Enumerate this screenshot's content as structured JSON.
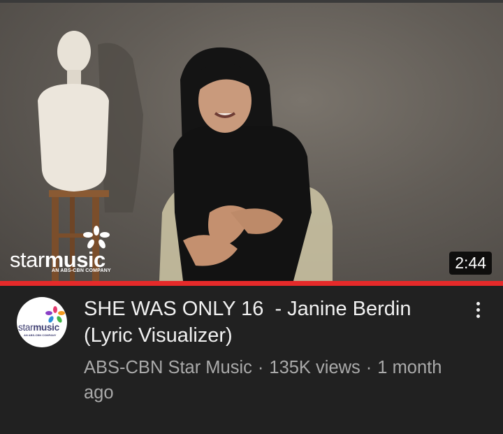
{
  "video": {
    "title": "SHE WAS ONLY 16  - Janine Berdin (Lyric Visualizer)",
    "duration": "2:44",
    "progress_fraction": 1.0,
    "colors": {
      "progress": "#e52a2a",
      "background": "#212121",
      "meta_text": "#aaaaaa"
    }
  },
  "watermark": {
    "wordmark_light": "star",
    "wordmark_bold": "music",
    "tagline": "AN ABS-CBN COMPANY"
  },
  "channel": {
    "name": "ABS-CBN Star Music",
    "avatar_wordmark_light": "star",
    "avatar_wordmark_bold": "music",
    "avatar_tagline": "AN ABS-CBN COMPANY"
  },
  "meta": {
    "separator": "·",
    "views": "135K views",
    "age": "1 month ago"
  },
  "icons": {
    "more": "more-vertical-icon",
    "watermark_logo": "starmusic-logo",
    "avatar_logo": "starmusic-logo"
  }
}
